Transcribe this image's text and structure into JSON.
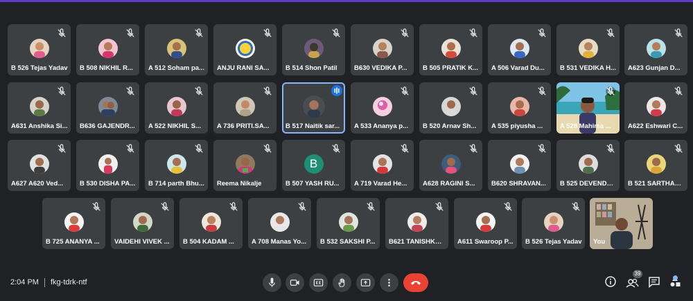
{
  "meeting": {
    "time": "2:04 PM",
    "code": "fkg-tdrk-ntf",
    "participant_count": "39"
  },
  "colors": {
    "background": "#202124",
    "tile": "#3c4043",
    "end_call": "#ea4335",
    "accent": "#1a73e8"
  },
  "participants": {
    "p1": "B 526 Tejas Yadav",
    "p2": "B 508 NIKHIL R...",
    "p3": "A 512 Soham pa...",
    "p4": "ANJU RANI SA...",
    "p5": "B 514 Shon Patil",
    "p6": "B630 VEDIKA P...",
    "p7": "B 505 PRATIK K...",
    "p8": "A 506 Varad Du...",
    "p9": "B 531 VEDIKA H...",
    "p10": "A623 Gunjan D...",
    "p11": "A631 Anshika Si...",
    "p12": "B636 GAJENDR...",
    "p13": "A 522 NIKHIL S...",
    "p14": "A 736 PRITI.SA...",
    "p15": "B 517 Naitik sar...",
    "p16": "A 533 Ananya p...",
    "p17": "B 520 Arnav Sh...",
    "p18": "A 535 piyusha ...",
    "p19": "A 528 Mahima ...",
    "p20": "A622 Eshwari C...",
    "p21": "A627 A620 Ved...",
    "p22": "B 530 DISHA PA...",
    "p23": "B 714 parth Bhu...",
    "p24": "Reema Nikalje",
    "p25": "B 507 YASH RU...",
    "p26": "A 719 Varad He...",
    "p27": "A628 RAGINI S...",
    "p28": "B620 SHRAVAN...",
    "p29": "B 525 DEVENDR...",
    "p30": "B 521 SARTHAK ...",
    "p31": "B 725 ANANYA ...",
    "p32": "VAIDEHI VIVEK ...",
    "p33": "B 504 KADAM ...",
    "p34": "A 708 Manas Yo...",
    "p35": "B 532 SAKSHI P...",
    "p36": "B621 TANISHKA ...",
    "p37": "A611 Swaroop P...",
    "p38": "B 526 Tejas Yadav",
    "p39": "You"
  },
  "avatar_letter": "B",
  "icons": {
    "mic_off": "mic-off-icon",
    "mic": "microphone-icon",
    "camera": "camera-icon",
    "captions": "captions-icon",
    "raise_hand": "raise-hand-icon",
    "present": "present-icon",
    "more": "more-options-icon",
    "end": "end-call-icon",
    "info": "info-icon",
    "people": "people-icon",
    "chat": "chat-icon",
    "activities": "activities-icon"
  }
}
